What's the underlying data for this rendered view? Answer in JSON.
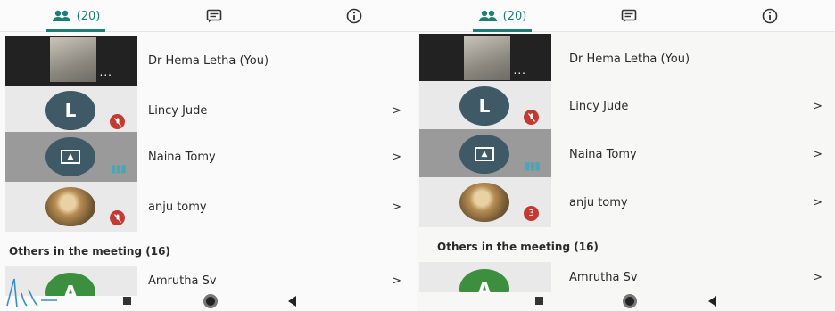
{
  "panels": [
    {
      "tabs": {
        "people_count": "(20)"
      },
      "participants": [
        {
          "name": "Dr Hema Letha (You)",
          "tile": "video",
          "more": "..."
        },
        {
          "name": "Lincy Jude",
          "tile": "avatar",
          "initial": "L",
          "badge": "mic-off",
          "chevron": ">"
        },
        {
          "name": "Naina Tomy",
          "tile": "presenting",
          "badge": "audio-level",
          "chevron": ">"
        },
        {
          "name": "anju tomy",
          "tile": "photo",
          "badge": "mic-off",
          "chevron": ">"
        }
      ],
      "others_header": "Others in the meeting (16)",
      "others": [
        {
          "name": "Amrutha Sv",
          "initial": "A",
          "chevron": ">"
        }
      ]
    },
    {
      "tabs": {
        "people_count": "(20)"
      },
      "participants": [
        {
          "name": "Dr Hema Letha (You)",
          "tile": "video",
          "more": "..."
        },
        {
          "name": "Lincy Jude",
          "tile": "avatar",
          "initial": "L",
          "badge": "mic-off",
          "chevron": ">"
        },
        {
          "name": "Naina Tomy",
          "tile": "presenting",
          "badge": "audio-level",
          "chevron": ">"
        },
        {
          "name": "anju tomy",
          "tile": "photo",
          "badge": "mic-off",
          "badge_text": "3",
          "chevron": ">"
        }
      ],
      "others_header": "Others in the meeting (16)",
      "others": [
        {
          "name": "Amrutha Sv",
          "initial": "A",
          "chevron": ">"
        }
      ]
    }
  ],
  "colors": {
    "accent": "#1e7e74",
    "mic_off": "#c23a32",
    "avatar_dark": "#3f5a66",
    "avatar_green": "#3b8f3e"
  },
  "icons": [
    "people-icon",
    "chat-icon",
    "info-icon",
    "mic-off-icon",
    "present-screen-icon",
    "more-options-icon",
    "chevron-right-icon",
    "nav-recents-icon",
    "nav-home-icon",
    "nav-back-icon"
  ]
}
